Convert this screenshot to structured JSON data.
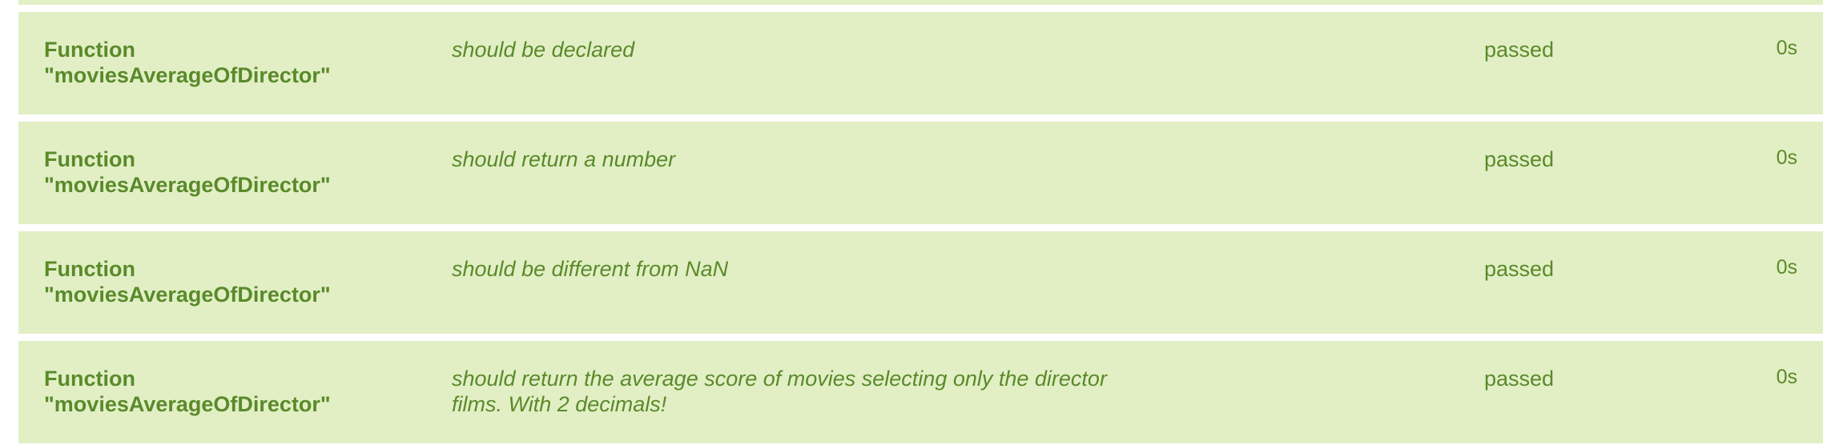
{
  "theme": {
    "row_background": "#e2efc5",
    "text_color": "#5a8a2a"
  },
  "results": [
    {
      "suite_line1": "Function",
      "suite_line2": "\"moviesAverageOfDirector\"",
      "description": "should be declared",
      "status": "passed",
      "duration": "0s"
    },
    {
      "suite_line1": "Function",
      "suite_line2": "\"moviesAverageOfDirector\"",
      "description": "should return a number",
      "status": "passed",
      "duration": "0s"
    },
    {
      "suite_line1": "Function",
      "suite_line2": "\"moviesAverageOfDirector\"",
      "description": "should be different from NaN",
      "status": "passed",
      "duration": "0s"
    },
    {
      "suite_line1": "Function",
      "suite_line2": "\"moviesAverageOfDirector\"",
      "description": "should return the average score of movies selecting only the director films. With 2 decimals!",
      "status": "passed",
      "duration": "0s"
    }
  ]
}
